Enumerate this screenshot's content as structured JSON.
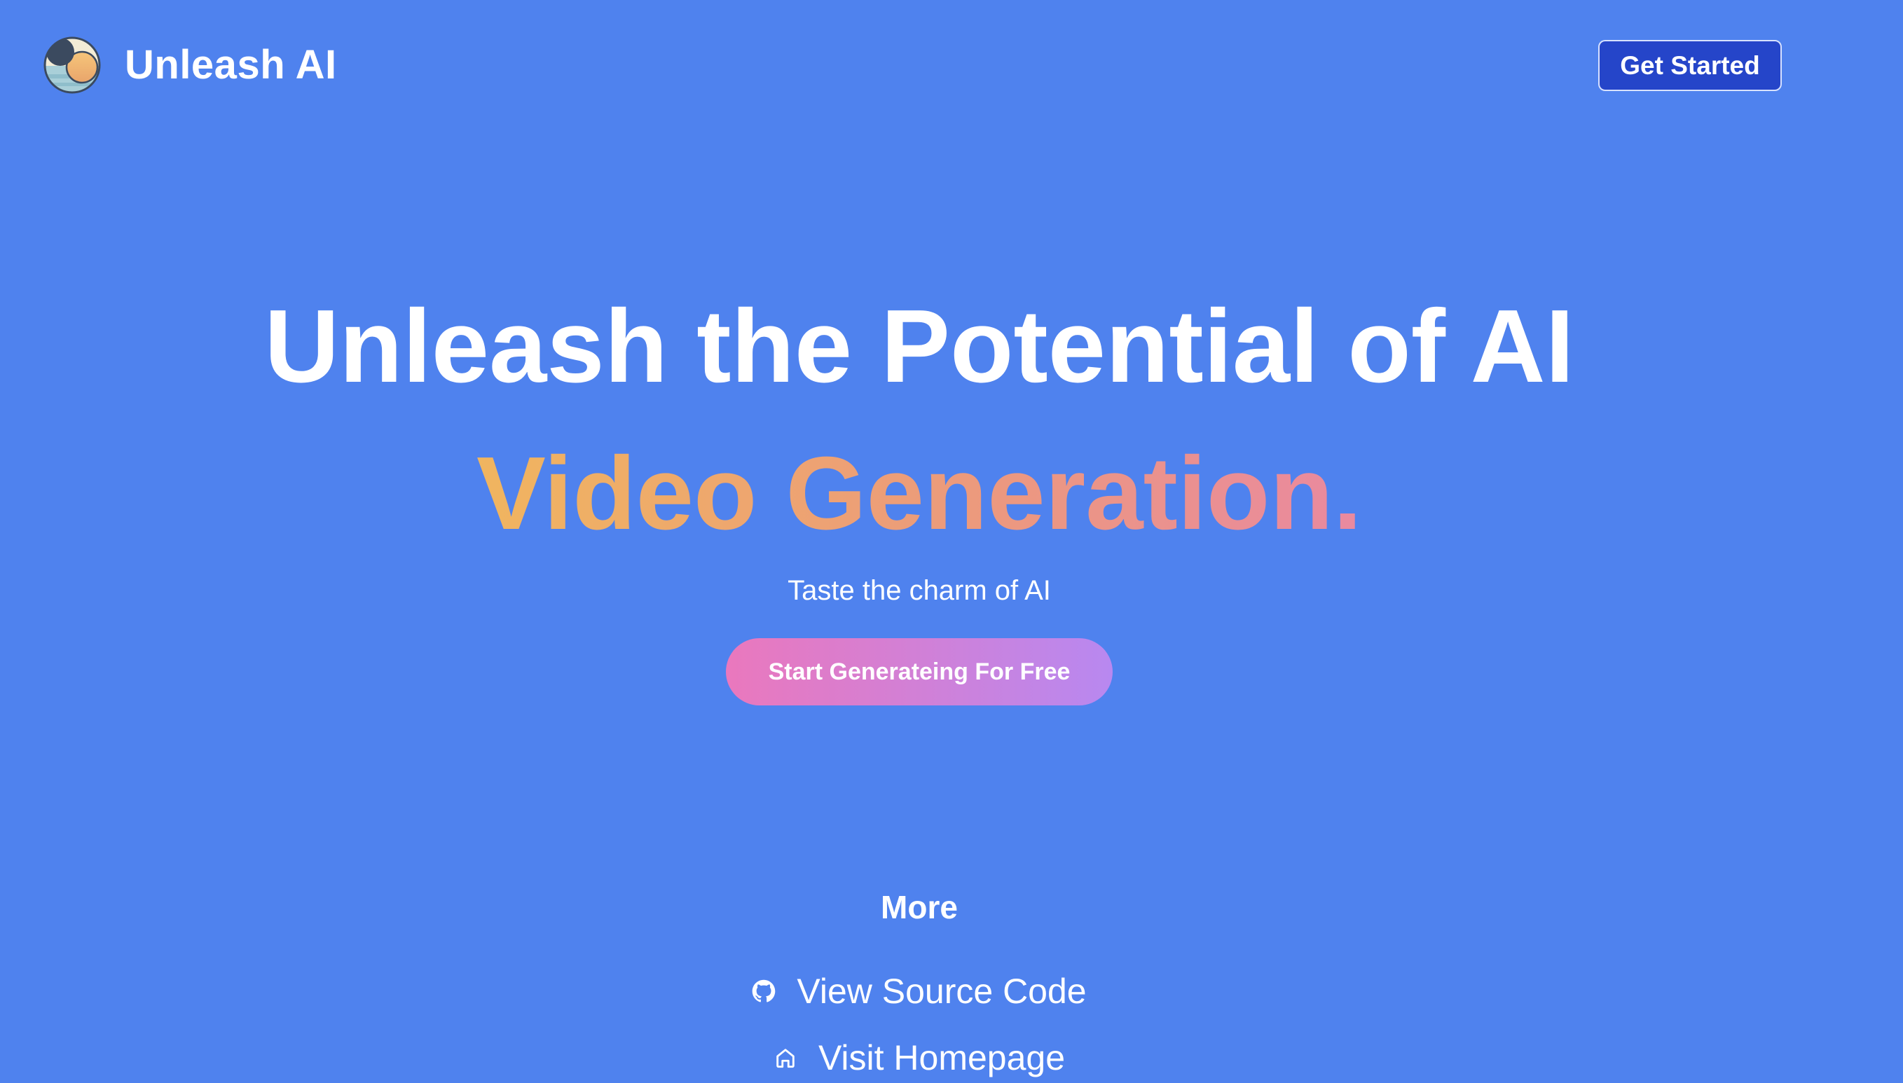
{
  "header": {
    "brand_name": "Unleash AI",
    "get_started_label": "Get Started"
  },
  "hero": {
    "title": "Unleash the Potential of AI",
    "subtitle": "Video Generation.",
    "tagline": "Taste the charm of AI",
    "cta_label": "Start Generateing For Free"
  },
  "more": {
    "title": "More",
    "links": [
      {
        "label": "View Source Code",
        "icon": "github-icon"
      },
      {
        "label": "Visit Homepage",
        "icon": "home-icon"
      }
    ]
  },
  "colors": {
    "background": "#4f82ee",
    "button_primary": "#2545c9",
    "gradient_text_start": "#f0b55f",
    "gradient_text_end": "#e989a0",
    "cta_gradient_start": "#ea78bd",
    "cta_gradient_end": "#b888f0"
  }
}
